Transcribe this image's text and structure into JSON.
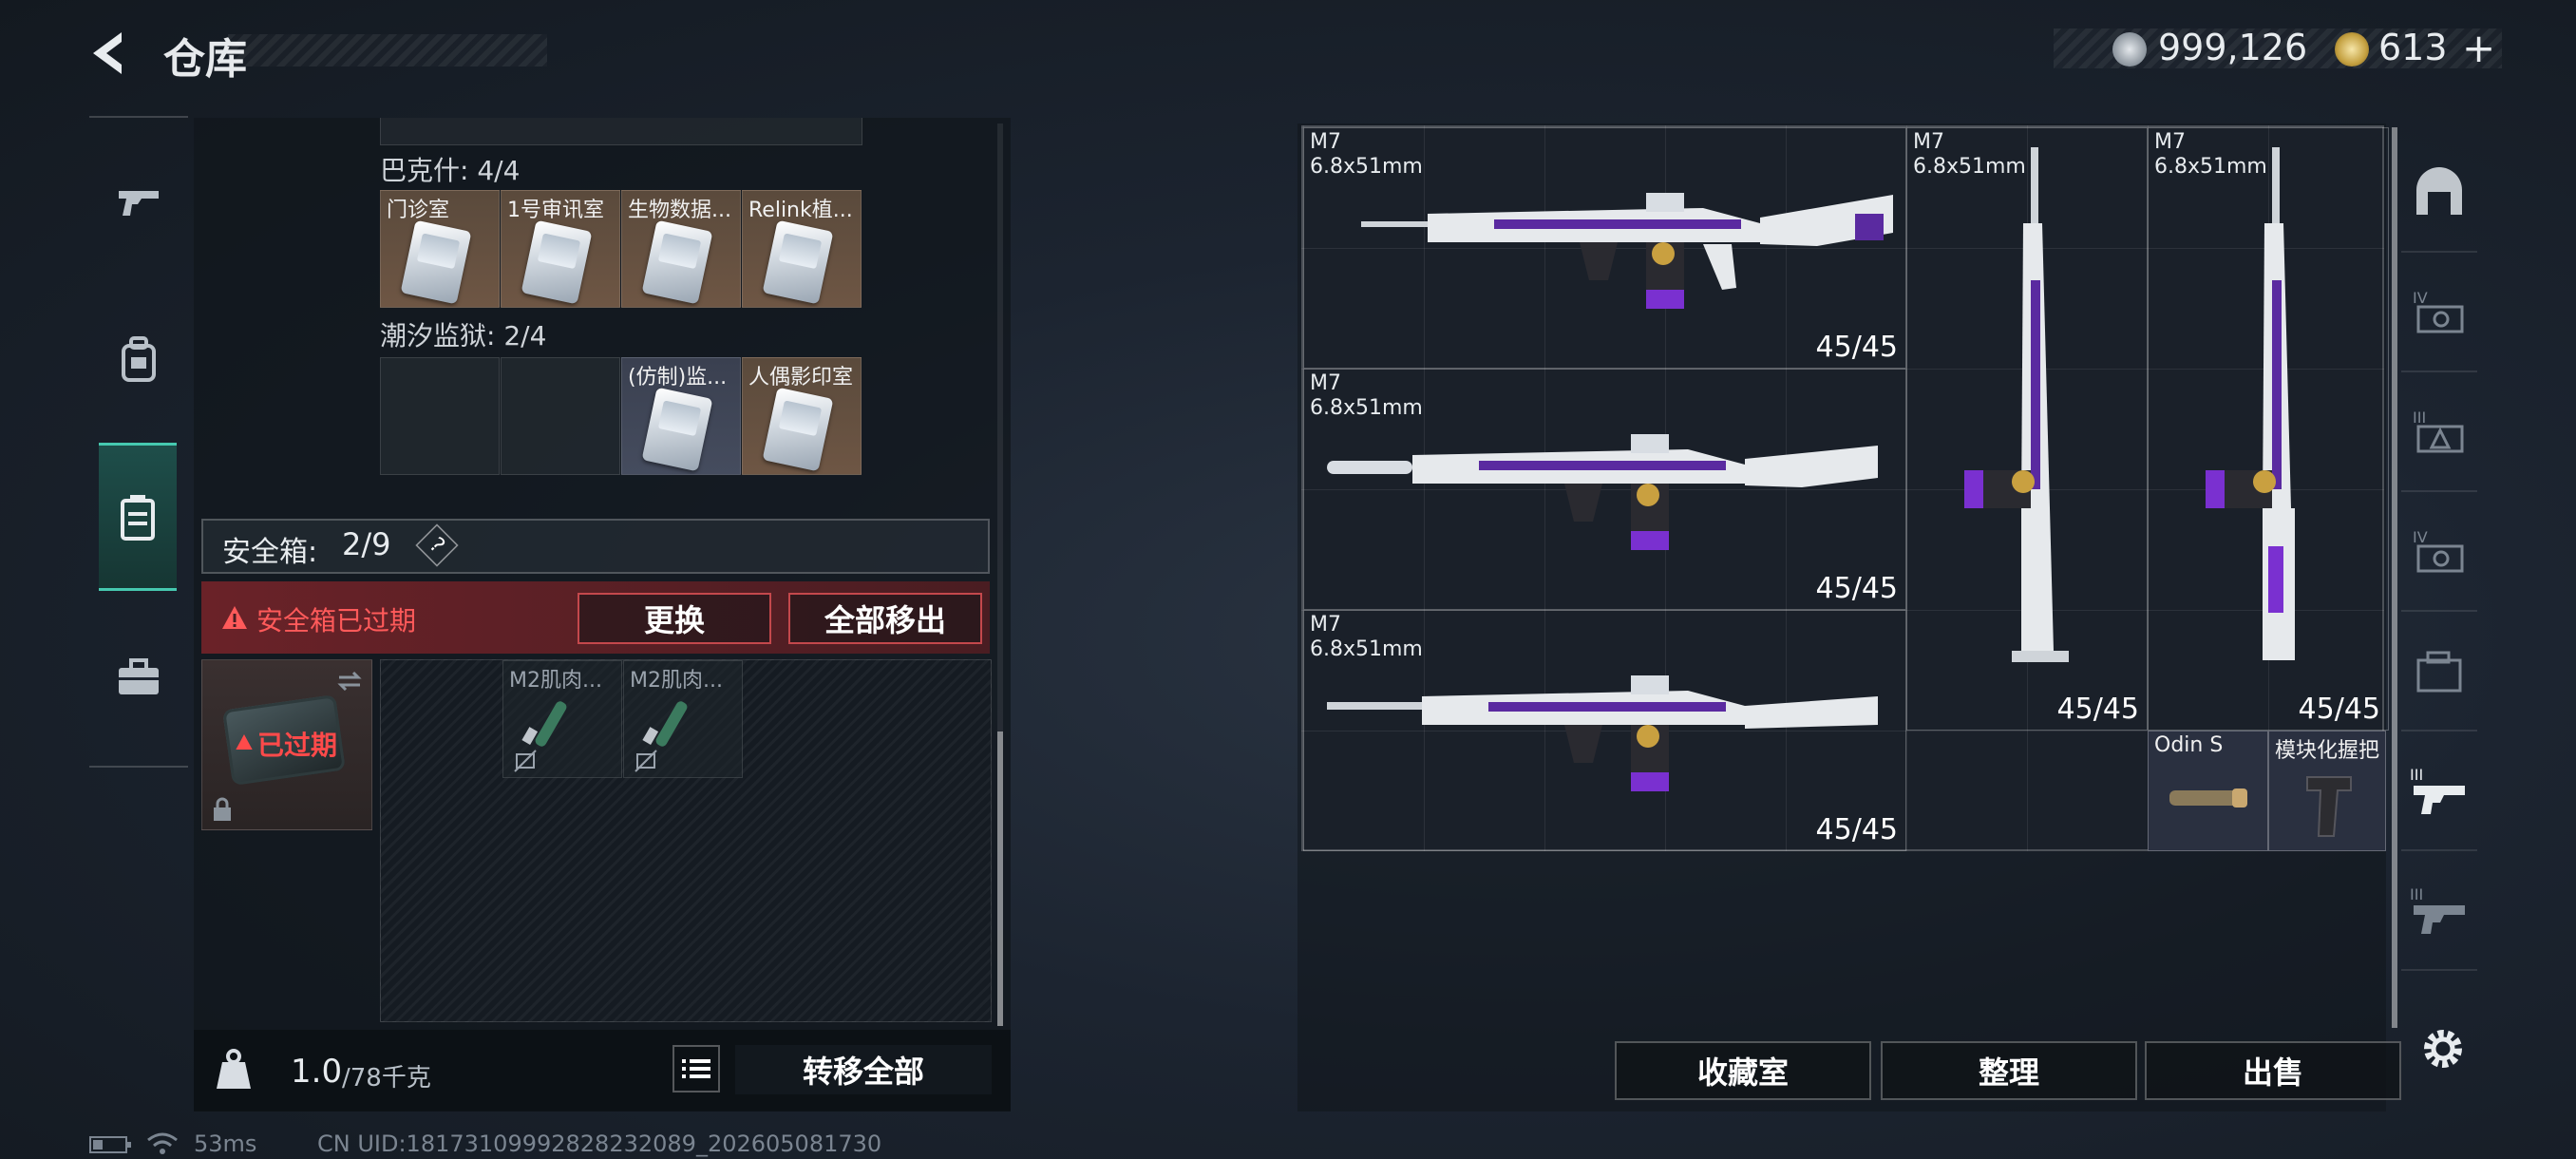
{
  "header": {
    "title": "仓库"
  },
  "currency": {
    "silver": "999,126",
    "gold": "613",
    "gold_plus": "+"
  },
  "sidebar": {
    "items": [
      {
        "icon": "gun-icon"
      },
      {
        "icon": "backpack-icon"
      },
      {
        "icon": "safebox-icon",
        "active": true
      },
      {
        "icon": "toolbox-icon"
      }
    ]
  },
  "left": {
    "group1": {
      "label": "巴克什: 4/4",
      "slots": [
        "门诊室",
        "1号审讯室",
        "生物数据...",
        "Relink植..."
      ]
    },
    "group2": {
      "label": "潮汐监狱: 2/4",
      "slots": [
        "",
        "",
        "(仿制)监...",
        "人偶影印室"
      ]
    },
    "safebox": {
      "label": "安全箱:",
      "count": "2/9",
      "help": "?"
    },
    "alert": {
      "text": "安全箱已过期",
      "replace_btn": "更换",
      "move_all_btn": "全部移出"
    },
    "expired_label": "已过期",
    "items": [
      "M2肌肉...",
      "M2肌肉..."
    ],
    "bottom": {
      "weight": "1.0",
      "weight_max": "/78千克",
      "transfer_all": "转移全部"
    }
  },
  "weapons": {
    "horizontal": [
      {
        "name": "M7",
        "caliber": "6.8x51mm",
        "ammo": "45/45"
      },
      {
        "name": "M7",
        "caliber": "6.8x51mm",
        "ammo": "45/45"
      },
      {
        "name": "M7",
        "caliber": "6.8x51mm",
        "ammo": "45/45"
      }
    ],
    "vertical": [
      {
        "name": "M7",
        "caliber": "6.8x51mm",
        "ammo": "45/45"
      },
      {
        "name": "M7",
        "caliber": "6.8x51mm",
        "ammo": "45/45"
      }
    ],
    "attachments": [
      "Odin S",
      "模块化握把"
    ]
  },
  "right_buttons": {
    "collection": "收藏室",
    "sort": "整理",
    "sell": "出售"
  },
  "footer": {
    "ping": "53ms",
    "uid": "CN UID:1817310999282823208​9_202605081730"
  }
}
